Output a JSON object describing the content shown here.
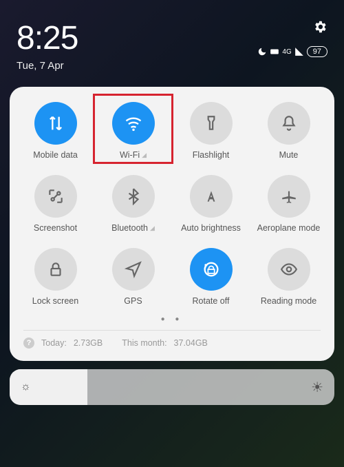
{
  "status": {
    "time": "8:25",
    "date": "Tue, 7 Apr",
    "battery": "97",
    "network_label": "4G"
  },
  "tiles": [
    {
      "id": "mobile-data",
      "label": "Mobile data",
      "active": true
    },
    {
      "id": "wifi",
      "label": "Wi-Fi",
      "active": true,
      "expandable": true,
      "highlighted": true
    },
    {
      "id": "flashlight",
      "label": "Flashlight",
      "active": false
    },
    {
      "id": "mute",
      "label": "Mute",
      "active": false
    },
    {
      "id": "screenshot",
      "label": "Screenshot",
      "active": false
    },
    {
      "id": "bluetooth",
      "label": "Bluetooth",
      "active": false,
      "expandable": true
    },
    {
      "id": "auto-brightness",
      "label": "Auto brightness",
      "active": false
    },
    {
      "id": "aeroplane",
      "label": "Aeroplane mode",
      "active": false
    },
    {
      "id": "lock-screen",
      "label": "Lock screen",
      "active": false
    },
    {
      "id": "gps",
      "label": "GPS",
      "active": false
    },
    {
      "id": "rotate-off",
      "label": "Rotate off",
      "active": true
    },
    {
      "id": "reading-mode",
      "label": "Reading mode",
      "active": false
    }
  ],
  "usage": {
    "today_label": "Today:",
    "today_value": "2.73GB",
    "month_label": "This month:",
    "month_value": "37.04GB"
  }
}
